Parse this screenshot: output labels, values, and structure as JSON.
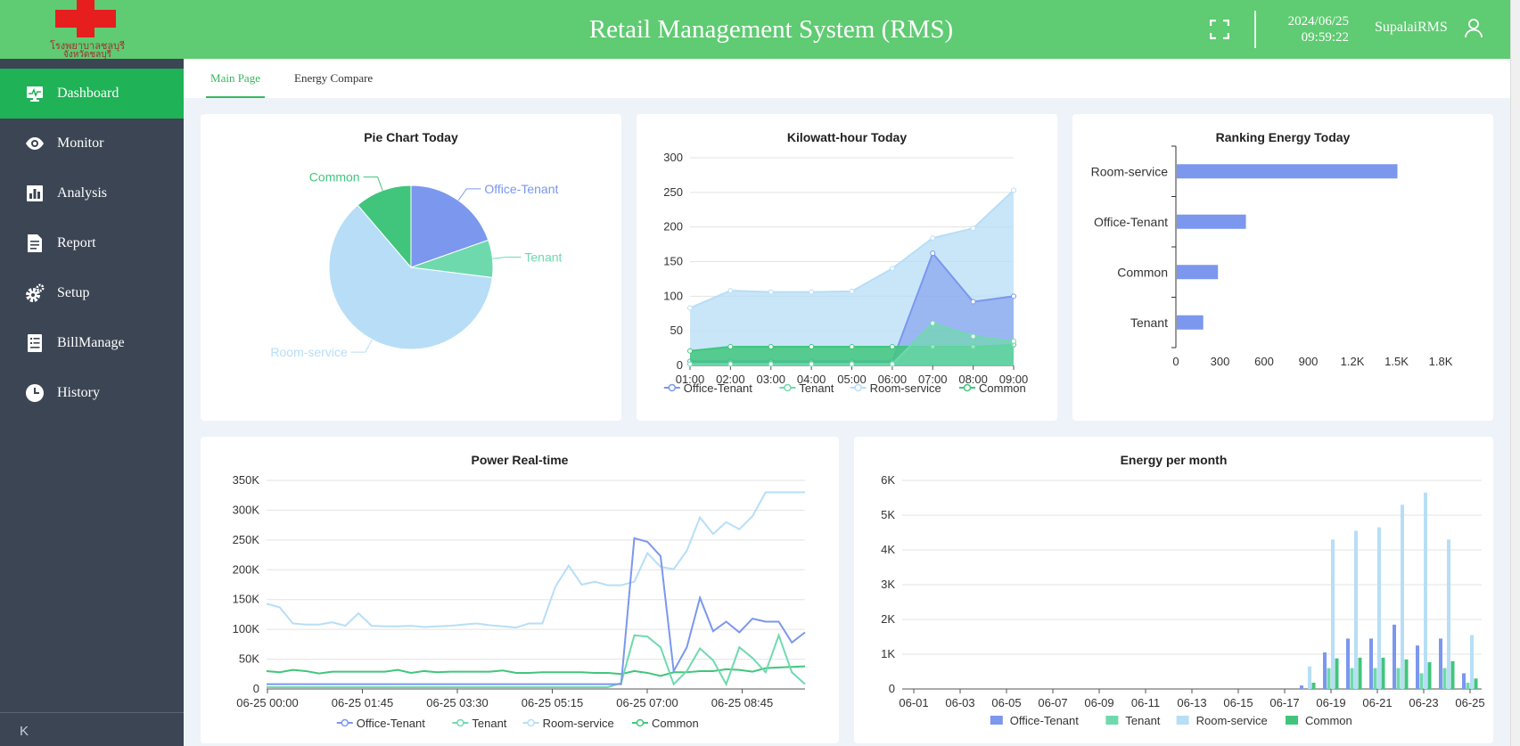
{
  "header": {
    "logo_line1": "โรงพยาบาลชลบุรี",
    "logo_line2": "จังหวัดชลบุรี",
    "title": "Retail Management System (RMS)",
    "date": "2024/06/25",
    "time": "09:59:22",
    "username": "SupalaiRMS"
  },
  "sidebar": {
    "items": [
      {
        "label": "Dashboard",
        "icon": "monitor-icon",
        "active": true
      },
      {
        "label": "Monitor",
        "icon": "eye-icon",
        "active": false
      },
      {
        "label": "Analysis",
        "icon": "bar-chart-icon",
        "active": false
      },
      {
        "label": "Report",
        "icon": "document-icon",
        "active": false
      },
      {
        "label": "Setup",
        "icon": "gear-icon",
        "active": false
      },
      {
        "label": "BillManage",
        "icon": "bill-icon",
        "active": false
      },
      {
        "label": "History",
        "icon": "clock-icon",
        "active": false
      }
    ],
    "collapse_label": "K"
  },
  "tabs": [
    {
      "label": "Main Page",
      "active": true
    },
    {
      "label": "Energy Compare",
      "active": false
    }
  ],
  "colors": {
    "office_tenant": "#7b97ee",
    "tenant": "#6fd9ae",
    "room_service": "#b7def6",
    "common": "#41c57d",
    "header_green": "#5fcb72",
    "active_green": "#20b256"
  },
  "chart_data": [
    {
      "type": "pie",
      "title": "Pie Chart Today",
      "slices": [
        {
          "name": "Office-Tenant",
          "value": 477
        },
        {
          "name": "Tenant",
          "value": 180
        },
        {
          "name": "Room-service",
          "value": 1503
        },
        {
          "name": "Common",
          "value": 274
        }
      ]
    },
    {
      "type": "area",
      "title": "Kilowatt-hour Today",
      "x": [
        "01:00",
        "02:00",
        "03:00",
        "04:00",
        "05:00",
        "06:00",
        "07:00",
        "08:00",
        "09:00"
      ],
      "ylim": [
        0,
        300
      ],
      "yticks": [
        0,
        50,
        100,
        150,
        200,
        250,
        300
      ],
      "series": [
        {
          "name": "Office-Tenant",
          "values": [
            6,
            6,
            6,
            6,
            6,
            6,
            162,
            92,
            100
          ]
        },
        {
          "name": "Tenant",
          "values": [
            2,
            2,
            2,
            2,
            2,
            2,
            61,
            42,
            35
          ]
        },
        {
          "name": "Room-service",
          "values": [
            83,
            108,
            106,
            106,
            107,
            140,
            184,
            198,
            253
          ]
        },
        {
          "name": "Common",
          "values": [
            21,
            27,
            27,
            27,
            27,
            27,
            27,
            27,
            30
          ]
        }
      ]
    },
    {
      "type": "bar",
      "orientation": "horizontal",
      "title": "Ranking Energy Today",
      "categories": [
        "Room-service",
        "Office-Tenant",
        "Common",
        "Tenant"
      ],
      "values": [
        1500,
        470,
        280,
        180
      ],
      "xlim": [
        0,
        1800
      ],
      "xticks": [
        "0",
        "300",
        "600",
        "900",
        "1.2K",
        "1.5K",
        "1.8K"
      ]
    },
    {
      "type": "line",
      "title": "Power Real-time",
      "xticks": [
        "06-25 00:00",
        "06-25 01:45",
        "06-25 03:30",
        "06-25 05:15",
        "06-25 07:00",
        "06-25 08:45"
      ],
      "ylim": [
        0,
        350000
      ],
      "yticks": [
        "0",
        "50K",
        "100K",
        "150K",
        "200K",
        "250K",
        "300K",
        "350K"
      ],
      "series": [
        {
          "name": "Office-Tenant",
          "values": [
            8000,
            8000,
            8000,
            8000,
            8000,
            8000,
            8000,
            8000,
            8000,
            8000,
            8000,
            8000,
            8000,
            8000,
            8000,
            8000,
            8000,
            8000,
            8000,
            8000,
            8000,
            8000,
            8000,
            8000,
            8000,
            8000,
            8000,
            8000,
            253000,
            247000,
            223000,
            30000,
            70000,
            153000,
            97000,
            113000,
            95000,
            118000,
            113000,
            113000,
            78000,
            95000
          ]
        },
        {
          "name": "Tenant",
          "values": [
            3000,
            3000,
            3000,
            3000,
            3000,
            3000,
            3000,
            3000,
            3000,
            3000,
            3000,
            3000,
            3000,
            3000,
            3000,
            3000,
            3000,
            3000,
            3000,
            3000,
            3000,
            3000,
            3000,
            3000,
            3000,
            3000,
            3000,
            10000,
            90000,
            88000,
            70000,
            8000,
            30000,
            68000,
            48000,
            8000,
            70000,
            52000,
            28000,
            90000,
            28000,
            8000
          ]
        },
        {
          "name": "Room-service",
          "values": [
            143000,
            137000,
            110000,
            108000,
            108000,
            112000,
            106000,
            127000,
            106000,
            105000,
            105000,
            106000,
            104000,
            105000,
            106000,
            108000,
            110000,
            107000,
            105000,
            103000,
            110000,
            110000,
            172000,
            207000,
            175000,
            180000,
            174000,
            174000,
            180000,
            228000,
            205000,
            201000,
            232000,
            288000,
            260000,
            280000,
            268000,
            290000,
            330000,
            330000,
            330000,
            330000
          ]
        },
        {
          "name": "Common",
          "values": [
            30000,
            28000,
            32000,
            30000,
            26000,
            29000,
            29000,
            29000,
            29000,
            29000,
            32000,
            27000,
            30000,
            28000,
            29000,
            29000,
            29000,
            29000,
            31000,
            27000,
            27000,
            28000,
            28000,
            28000,
            28000,
            27000,
            27000,
            25000,
            30000,
            27000,
            22000,
            28000,
            28000,
            30000,
            30000,
            33000,
            32000,
            29000,
            35000,
            36000,
            37000,
            38000
          ]
        }
      ]
    },
    {
      "type": "bar",
      "title": "Energy per month",
      "categories": [
        "06-01",
        "06-02",
        "06-03",
        "06-04",
        "06-05",
        "06-06",
        "06-07",
        "06-08",
        "06-09",
        "06-10",
        "06-11",
        "06-12",
        "06-13",
        "06-14",
        "06-15",
        "06-16",
        "06-17",
        "06-18",
        "06-19",
        "06-20",
        "06-21",
        "06-22",
        "06-23",
        "06-24",
        "06-25"
      ],
      "xticks": [
        "06-01",
        "06-03",
        "06-05",
        "06-07",
        "06-09",
        "06-11",
        "06-13",
        "06-15",
        "06-17",
        "06-19",
        "06-21",
        "06-23",
        "06-25"
      ],
      "ylim": [
        0,
        6000
      ],
      "yticks": [
        "0",
        "1K",
        "2K",
        "3K",
        "4K",
        "5K",
        "6K"
      ],
      "series": [
        {
          "name": "Office-Tenant",
          "values": [
            0,
            0,
            0,
            0,
            0,
            0,
            0,
            0,
            0,
            0,
            0,
            0,
            0,
            0,
            0,
            0,
            0,
            100,
            1050,
            1450,
            1450,
            1850,
            1250,
            1450,
            450
          ]
        },
        {
          "name": "Tenant",
          "values": [
            0,
            0,
            0,
            0,
            0,
            0,
            0,
            0,
            0,
            0,
            0,
            0,
            0,
            0,
            0,
            0,
            0,
            0,
            600,
            600,
            600,
            600,
            450,
            600,
            180
          ]
        },
        {
          "name": "Room-service",
          "values": [
            0,
            0,
            0,
            0,
            0,
            0,
            0,
            0,
            0,
            0,
            0,
            0,
            0,
            0,
            0,
            0,
            0,
            650,
            4300,
            4550,
            4650,
            5300,
            5650,
            4300,
            1550
          ]
        },
        {
          "name": "Common",
          "values": [
            0,
            0,
            0,
            0,
            0,
            0,
            0,
            0,
            0,
            0,
            0,
            0,
            0,
            0,
            0,
            0,
            0,
            180,
            880,
            900,
            900,
            850,
            770,
            800,
            300
          ]
        }
      ]
    }
  ]
}
